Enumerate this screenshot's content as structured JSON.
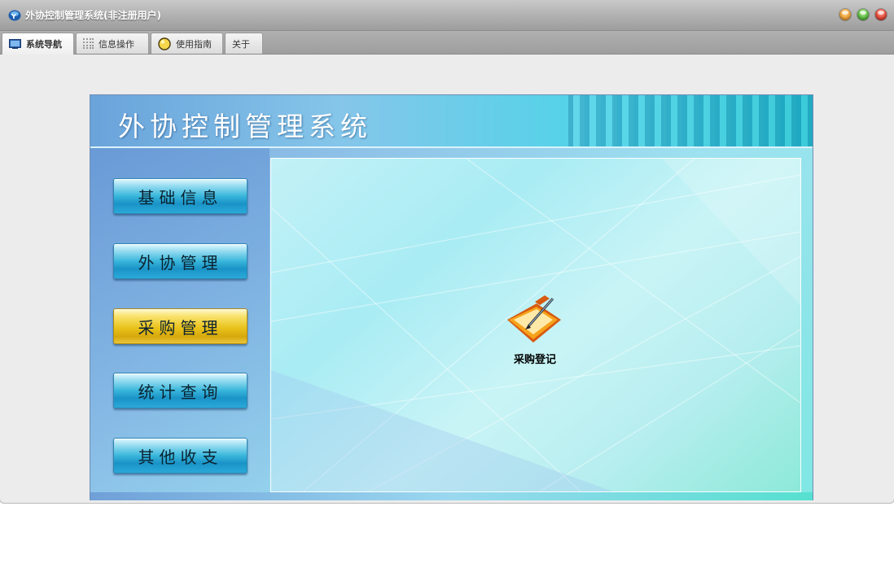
{
  "window": {
    "title": "外协控制管理系统(非注册用户)",
    "icons": {
      "logo": "app-logo-icon",
      "buttons": [
        "minimize-icon",
        "maximize-icon",
        "close-icon"
      ]
    },
    "button_colors": {
      "minimize": "#f0a43c",
      "maximize": "#5dbb43",
      "close": "#e24a3a"
    }
  },
  "tabs": [
    {
      "label": "系统导航",
      "icon": "monitor-icon",
      "active": true
    },
    {
      "label": "信息操作",
      "icon": "grid-icon",
      "active": false
    },
    {
      "label": "使用指南",
      "icon": "circle-icon",
      "active": false
    },
    {
      "label": "关于",
      "icon": "",
      "active": false
    }
  ],
  "header": {
    "title": "外协控制管理系统"
  },
  "sidebar": {
    "items": [
      {
        "label": "基础信息",
        "active": false
      },
      {
        "label": "外协管理",
        "active": false
      },
      {
        "label": "采购管理",
        "active": true
      },
      {
        "label": "统计查询",
        "active": false
      },
      {
        "label": "其他收支",
        "active": false
      }
    ]
  },
  "main": {
    "functions": [
      {
        "label": "采购登记",
        "icon": "folder-pen-icon"
      }
    ]
  },
  "colors": {
    "accent_blue": "#1a93c7",
    "accent_gold": "#e9c21b",
    "header_cyan": "#29c6d6"
  }
}
